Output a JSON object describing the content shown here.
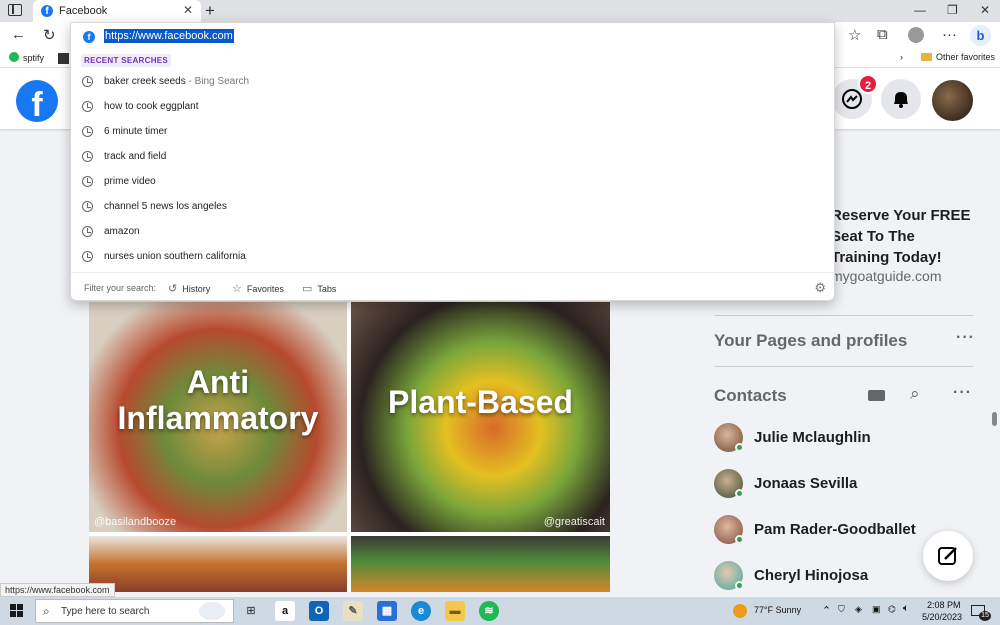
{
  "browser": {
    "tab_title": "Facebook",
    "tab_close": "✕",
    "new_tab": "+",
    "window_controls": [
      "—",
      "❐",
      "✕"
    ],
    "bookmarks": [
      {
        "label": "sptify",
        "icon": "spotify-icon"
      },
      {
        "label": "Other favorites",
        "icon": "folder-icon"
      }
    ],
    "address": {
      "url": "https://www.facebook.com"
    }
  },
  "omnibox": {
    "recent_heading": "RECENT SEARCHES",
    "suggestions": [
      {
        "text": "baker creek seeds",
        "sub": " - Bing Search"
      },
      {
        "text": "how to cook eggplant",
        "sub": ""
      },
      {
        "text": "6 minute timer",
        "sub": ""
      },
      {
        "text": "track and field",
        "sub": ""
      },
      {
        "text": "prime video",
        "sub": ""
      },
      {
        "text": "channel 5 news los angeles",
        "sub": ""
      },
      {
        "text": "amazon",
        "sub": ""
      },
      {
        "text": "nurses union southern california",
        "sub": ""
      }
    ],
    "filter_label": "Filter your search:",
    "filters": [
      "History",
      "Favorites",
      "Tabs"
    ]
  },
  "facebook": {
    "logo": "f",
    "messenger_badge": "2",
    "feed": {
      "quads": [
        {
          "label": "Anti Inflammatory",
          "handle": "@basilandbooze"
        },
        {
          "label": "Plant-Based",
          "handle": "@greatiscait"
        }
      ]
    },
    "sponsored": {
      "text_lines": [
        "Reserve Your FREE",
        "Seat To The",
        "Training Today!"
      ],
      "url": "mygoatguide.com"
    },
    "pages_title": "Your Pages and profiles",
    "contacts_title": "Contacts",
    "contacts": [
      {
        "name": "Julie Mclaughlin",
        "color": "#b08a6e"
      },
      {
        "name": "Jonaas Sevilla",
        "color": "#5a6b4d"
      },
      {
        "name": "Pam Rader-Goodballet",
        "color": "#a27460"
      },
      {
        "name": "Cheryl Hinojosa",
        "color": "#3fa8a0"
      }
    ]
  },
  "status_url": "https://www.facebook.com",
  "taskbar": {
    "search_placeholder": "Type here to search",
    "weather": "77°F  Sunny",
    "time": "2:08 PM",
    "date": "5/20/2023",
    "notification_count": "15"
  }
}
